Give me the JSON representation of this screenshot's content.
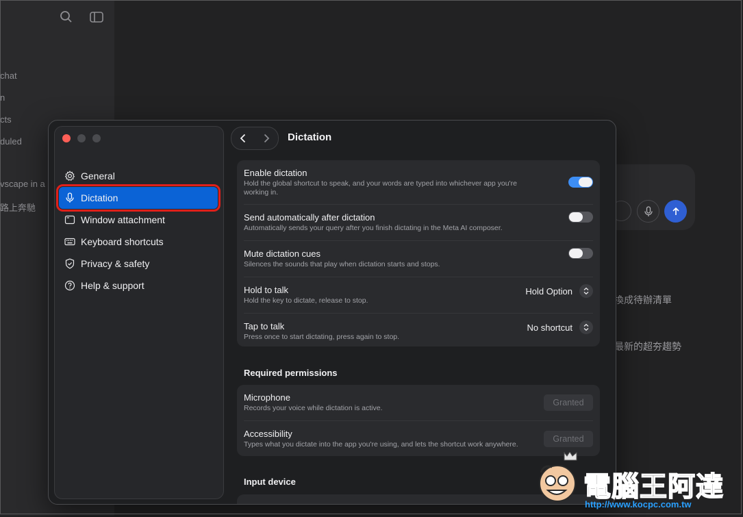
{
  "background_app": {
    "sidebar_items": [
      "chat",
      "n",
      "cts",
      "duled",
      "vscape in a",
      "路上奔馳"
    ],
    "right_texts": [
      "換成待辦清單",
      "最新的超夯趨勢"
    ]
  },
  "settings": {
    "sidebar": {
      "items": [
        {
          "label": "General",
          "icon": "gear-icon"
        },
        {
          "label": "Dictation",
          "icon": "microphone-icon"
        },
        {
          "label": "Window attachment",
          "icon": "window-icon"
        },
        {
          "label": "Keyboard shortcuts",
          "icon": "keyboard-icon"
        },
        {
          "label": "Privacy & safety",
          "icon": "shield-icon"
        },
        {
          "label": "Help & support",
          "icon": "help-icon"
        }
      ],
      "active": "Dictation"
    },
    "page_title": "Dictation",
    "dictation_rows": [
      {
        "title": "Enable dictation",
        "desc": "Hold the global shortcut to speak, and your words are typed into whichever app you're working in.",
        "toggle": true
      },
      {
        "title": "Send automatically after dictation",
        "desc": "Automatically sends your query after you finish dictating in the Meta AI composer.",
        "toggle": false
      },
      {
        "title": "Mute dictation cues",
        "desc": "Silences the sounds that play when dictation starts and stops.",
        "toggle": false
      },
      {
        "title": "Hold to talk",
        "desc": "Hold the key to dictate, release to stop.",
        "value": "Hold Option"
      },
      {
        "title": "Tap to talk",
        "desc": "Press once to start dictating, press again to stop.",
        "value": "No shortcut"
      }
    ],
    "permissions_title": "Required permissions",
    "permissions": [
      {
        "title": "Microphone",
        "desc": "Records your voice while dictation is active.",
        "status": "Granted"
      },
      {
        "title": "Accessibility",
        "desc": "Types what you dictate into the app you're using, and lets the shortcut work anywhere.",
        "status": "Granted"
      }
    ],
    "input_device_title": "Input device"
  },
  "watermark": {
    "text": "電腦王阿達",
    "url": "http://www.kocpc.com.tw"
  },
  "colors": {
    "accent": "#0b63d6",
    "highlight_border": "#e0201a",
    "toggle_on": "#3d8ef5",
    "toggle_off": "#56575c",
    "close": "#ff5f57"
  }
}
